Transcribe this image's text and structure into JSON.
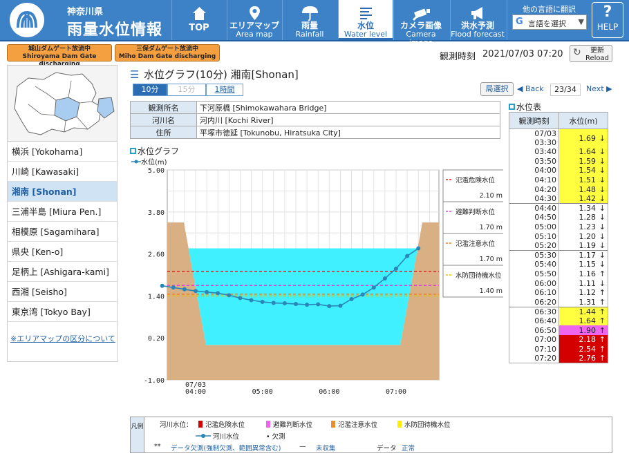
{
  "header": {
    "pref": "神奈川県",
    "title": "雨量水位情報"
  },
  "nav": [
    {
      "l1": "TOP",
      "l2": "",
      "icon": "home-icon"
    },
    {
      "l1": "エリアマップ",
      "l2": "Area map",
      "icon": "map-pin-icon"
    },
    {
      "l1": "雨量",
      "l2": "Rainfall",
      "icon": "umbrella-icon"
    },
    {
      "l1": "水位",
      "l2": "Water level",
      "icon": "water-level-icon"
    },
    {
      "l1": "カメラ画像",
      "l2": "Camera image",
      "icon": "camera-icon"
    },
    {
      "l1": "洪水予測",
      "l2": "Flood forecast",
      "icon": "megaphone-icon"
    }
  ],
  "translate": {
    "label": "他の言語に翻訳",
    "select": "言語を選択",
    "g": "G",
    "arrow": "▼"
  },
  "help": {
    "q": "?",
    "label": "HELP"
  },
  "dam": [
    {
      "jp": "城山ダムゲート放流中",
      "en": "Shiroyama Dam Gate discharging"
    },
    {
      "jp": "三保ダムゲート放流中",
      "en": "Miho Dam Gate discharging"
    }
  ],
  "obs": {
    "label": "観測時刻",
    "time": "2021/07/03 07:20"
  },
  "reload": {
    "jp": "更新",
    "en": "Reload",
    "icon": "↻"
  },
  "sidebar": {
    "items": [
      "横浜 [Yokohama]",
      "川崎 [Kawasaki]",
      "湘南 [Shonan]",
      "三浦半島 [Miura Pen.]",
      "相模原 [Sagamihara]",
      "県央 [Ken-o]",
      "足柄上 [Ashigara-kami]",
      "西湘 [Seisho]",
      "東京湾 [Tokyo Bay]"
    ],
    "selected": 2,
    "link": "※エリアマップの区分について"
  },
  "page": {
    "title": "水位グラフ(10分)  湘南[Shonan]",
    "tabs": [
      "10分",
      "15分",
      "1時間"
    ],
    "kyoku": "局選択",
    "back": "◀ Back",
    "pageinfo": "23/34",
    "next": "Next ▶"
  },
  "info": [
    {
      "k": "観測所名",
      "v": "下河原橋 [Shimokawahara Bridge]"
    },
    {
      "k": "河川名",
      "v": "河内川 [Kochi River]"
    },
    {
      "k": "住所",
      "v": "平塚市徳延 [Tokunobu, Hiratsuka City]"
    }
  ],
  "graph": {
    "title": "水位グラフ",
    "legend": "水位(m)"
  },
  "thresholds": [
    {
      "name": "氾濫危険水位",
      "value": "2.10 m",
      "v": 2.1,
      "color": "#e02020"
    },
    {
      "name": "避難判断水位",
      "value": "1.70 m",
      "v": 1.7,
      "color": "#e040e0"
    },
    {
      "name": "氾濫注意水位",
      "value": "1.70 m",
      "v": 1.45,
      "color": "#f08020"
    },
    {
      "name": "水防団待機水位",
      "value": "1.40 m",
      "v": 1.4,
      "color": "#e8c000"
    }
  ],
  "chart_data": {
    "type": "line",
    "ylim": [
      -1.0,
      5.0
    ],
    "yticks": [
      "5.00",
      "3.80",
      "2.60",
      "1.40",
      "0.20",
      "-1.00"
    ],
    "xticks": [
      {
        "label": "07/03\n04:00",
        "t": 0
      },
      {
        "label": "05:00",
        "t": 60
      },
      {
        "label": "06:00",
        "t": 120
      },
      {
        "label": "07:00",
        "t": 180
      }
    ],
    "x": [
      -20,
      -10,
      0,
      10,
      20,
      30,
      40,
      50,
      60,
      70,
      80,
      90,
      100,
      110,
      120,
      130,
      140,
      150,
      160,
      170,
      180,
      190,
      200
    ],
    "series": [
      {
        "name": "水位(m)",
        "values": [
          1.69,
          1.64,
          1.59,
          1.54,
          1.51,
          1.48,
          1.42,
          1.34,
          1.28,
          1.23,
          1.2,
          1.19,
          1.17,
          1.15,
          1.16,
          1.11,
          1.12,
          1.31,
          1.44,
          1.64,
          1.9,
          2.18,
          2.54,
          2.76
        ]
      }
    ]
  },
  "table": {
    "title": "水位表",
    "headers": [
      "観測時刻",
      "水位(m)"
    ],
    "rows": [
      {
        "t": "07/03 03:30",
        "v": "1.69",
        "a": "↓",
        "c": "y"
      },
      {
        "t": "03:40",
        "v": "1.64",
        "a": "↓",
        "c": "y"
      },
      {
        "t": "03:50",
        "v": "1.59",
        "a": "↓",
        "c": "y"
      },
      {
        "t": "04:00",
        "v": "1.54",
        "a": "↓",
        "c": "y"
      },
      {
        "t": "04:10",
        "v": "1.51",
        "a": "↓",
        "c": "y"
      },
      {
        "t": "04:20",
        "v": "1.48",
        "a": "↓",
        "c": "y"
      },
      {
        "t": "04:30",
        "v": "1.42",
        "a": "↓",
        "c": "y"
      },
      {
        "t": "04:40",
        "v": "1.34",
        "a": "↓",
        "c": "w"
      },
      {
        "t": "04:50",
        "v": "1.28",
        "a": "↓",
        "c": "w"
      },
      {
        "t": "05:00",
        "v": "1.23",
        "a": "↓",
        "c": "w"
      },
      {
        "t": "05:10",
        "v": "1.20",
        "a": "↓",
        "c": "w"
      },
      {
        "t": "05:20",
        "v": "1.19",
        "a": "↓",
        "c": "w"
      },
      {
        "t": "05:30",
        "v": "1.17",
        "a": "↓",
        "c": "w"
      },
      {
        "t": "05:40",
        "v": "1.15",
        "a": "↓",
        "c": "w"
      },
      {
        "t": "05:50",
        "v": "1.16",
        "a": "↑",
        "c": "w"
      },
      {
        "t": "06:00",
        "v": "1.11",
        "a": "↓",
        "c": "w"
      },
      {
        "t": "06:10",
        "v": "1.12",
        "a": "↑",
        "c": "w"
      },
      {
        "t": "06:20",
        "v": "1.31",
        "a": "↑",
        "c": "w"
      },
      {
        "t": "06:30",
        "v": "1.44",
        "a": "↑",
        "c": "y"
      },
      {
        "t": "06:40",
        "v": "1.64",
        "a": "↑",
        "c": "y"
      },
      {
        "t": "06:50",
        "v": "1.90",
        "a": "↑",
        "c": "p"
      },
      {
        "t": "07:00",
        "v": "2.18",
        "a": "↑",
        "c": "r"
      },
      {
        "t": "07:10",
        "v": "2.54",
        "a": "↑",
        "c": "r"
      },
      {
        "t": "07:20",
        "v": "2.76",
        "a": "↑",
        "c": "r"
      }
    ]
  },
  "legend": {
    "side": "凡例",
    "river": "河川水位：",
    "items": [
      "氾濫危険水位",
      "避難判断水位",
      "氾濫注意水位",
      "水防団待機水位"
    ],
    "line": "河川水位",
    "kessoku": "欠測",
    "star": "**",
    "missing": "データ欠測(強制欠測、範囲異常含む)",
    "dash": "—",
    "mishu": "未収集",
    "data": "データ",
    "seijo": "正常"
  },
  "colors": {
    "yellow": "#ffff40",
    "pink": "#ee66ee",
    "red": "#d40000",
    "cyan": "#40f0ff",
    "bank": "#d9b084",
    "line": "#2a86b8"
  }
}
